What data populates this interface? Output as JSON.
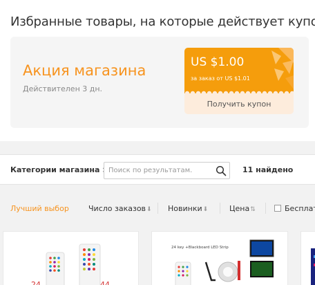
{
  "featured": {
    "title": "Избранные товары, на которые действует купон магазина"
  },
  "promo": {
    "title": "Акция магазина",
    "validity": "Действителен 3 дн."
  },
  "coupon": {
    "amount": "US $1.00",
    "condition": "за заказ от US $1.01",
    "button_label": "Получить купон"
  },
  "filter": {
    "categories_label": "Категории магазина >",
    "search_placeholder": "Поиск по результатам.",
    "found_count": "11 найдено"
  },
  "sort": {
    "best": "Лучший выбор",
    "orders": "Число заказов",
    "newest": "Новинки",
    "price": "Цена",
    "free_shipping": "Бесплатная доставка"
  },
  "products": [
    {
      "label_left": "24",
      "label_right": "44"
    },
    {
      "header": "24 key +Blackboard LED Strip"
    },
    {},
    {}
  ],
  "colors": {
    "accent": "#f7931e",
    "coupon_bg": "#f59d0c",
    "coupon_bottom": "#fdecdc"
  }
}
